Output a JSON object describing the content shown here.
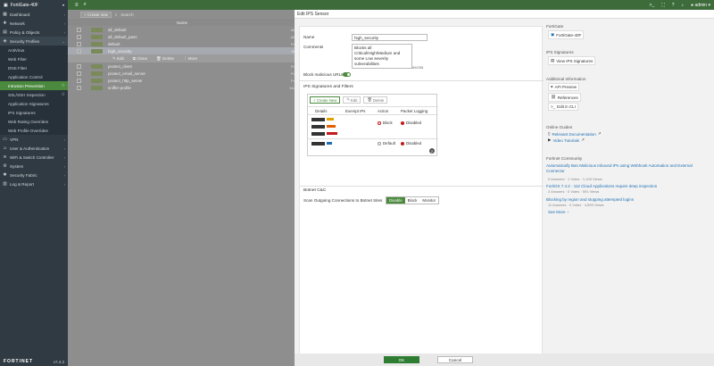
{
  "topbar": {
    "device_name": "FortiGate-40F",
    "user": "admin"
  },
  "sidebar": {
    "items": [
      {
        "label": "Dashboard",
        "icon": "dashboard-icon"
      },
      {
        "label": "Network",
        "icon": "network-icon"
      },
      {
        "label": "Policy & Objects",
        "icon": "policy-icon"
      },
      {
        "label": "Security Profiles",
        "icon": "shield-icon"
      }
    ],
    "security_sub": [
      {
        "label": "AntiVirus"
      },
      {
        "label": "Web Filter"
      },
      {
        "label": "DNS Filter"
      },
      {
        "label": "Application Control"
      },
      {
        "label": "Intrusion Prevention",
        "active": true
      },
      {
        "label": "SSL/SSH Inspection"
      },
      {
        "label": "Application Signatures"
      },
      {
        "label": "IPS Signatures"
      },
      {
        "label": "Web Rating Overrides"
      },
      {
        "label": "Web Profile Overrides"
      }
    ],
    "items2": [
      {
        "label": "VPN",
        "icon": "vpn-icon"
      },
      {
        "label": "User & Authentication",
        "icon": "user-icon"
      },
      {
        "label": "WiFi & Switch Controller",
        "icon": "wifi-icon"
      },
      {
        "label": "System",
        "icon": "gear-icon"
      },
      {
        "label": "Security Fabric",
        "icon": "fabric-icon"
      },
      {
        "label": "Log & Report",
        "icon": "log-icon"
      }
    ],
    "logo": "FORTINET",
    "version": "v7.4.3"
  },
  "list": {
    "create_new": "+ Create new",
    "search_placeholder": "Search",
    "column_name": "Name",
    "rows": [
      {
        "name": "all_default",
        "rt": "All"
      },
      {
        "name": "all_default_pass",
        "rt": "All"
      },
      {
        "name": "default",
        "rt": "Pr"
      },
      {
        "name": "high_security",
        "rt": "Bl",
        "selected": true
      },
      {
        "name": "protect_client",
        "rt": "Pr"
      },
      {
        "name": "protect_email_server",
        "rt": "Pr"
      },
      {
        "name": "protect_http_server",
        "rt": "Pr"
      },
      {
        "name": "sniffer-profile",
        "rt": "Mo"
      }
    ],
    "actions": {
      "edit": "Edit",
      "clone": "Clone",
      "delete": "Delete",
      "more": "More"
    }
  },
  "modal": {
    "title": "Edit IPS Sensor",
    "name_label": "Name",
    "name_value": "high_security",
    "comments_label": "Comments",
    "comments_value": "Blocks all Critical/High/Medium and some Low severity vulnerabilities",
    "comments_counter": "69/255",
    "block_malicious_label": "Block malicious URLs",
    "ips_section_title": "IPS Signatures and Filters",
    "create_new": "+ Create New",
    "edit": "Edit",
    "delete": "Delete",
    "col_details": "Details",
    "col_exempt": "Exempt IPs",
    "col_action": "Action",
    "col_packet": "Packet Logging",
    "row1_action": "Block",
    "row1_packet": "Disabled",
    "row2_action": "Default",
    "row2_packet": "Disabled",
    "row_count": "2",
    "botnet_title": "Botnet C&C",
    "botnet_label": "Scan Outgoing Connections to Botnet Sites",
    "botnet_options": [
      "Disable",
      "Block",
      "Monitor"
    ],
    "botnet_selected": "Disable",
    "ok": "OK",
    "cancel": "Cancel"
  },
  "right": {
    "device_section": "FortiGate",
    "device_name": "FortiGate-40F",
    "ips_sigs_section": "IPS Signatures",
    "view_ips_sigs": "View IPS Signatures",
    "additional_section": "Additional Information",
    "api_preview": "API Preview",
    "references": "References",
    "edit_cli": "Edit in CLI",
    "online_guides": "Online Guides",
    "relevant_docs": "Relevant Documentation",
    "video_tutorials": "Video Tutorials",
    "community_section": "Fortinet Community",
    "posts": [
      {
        "title": "Automatically Ban Malicious Inbound IPs using Webhook Automation and External Connector",
        "meta": "0 Answers   ·   1 Votes   ·   1,100 Views"
      },
      {
        "title": "FortiOS 7.4.2 - 112 Cloud Applications require deep inspection",
        "meta": "2 Answers   ·   0 Votes   ·   591 Views"
      },
      {
        "title": "Blocking by region and stopping attempted logins",
        "meta": "11 Answers   ·   0 Votes   ·   4,899 Views"
      }
    ],
    "see_more": "See More"
  }
}
